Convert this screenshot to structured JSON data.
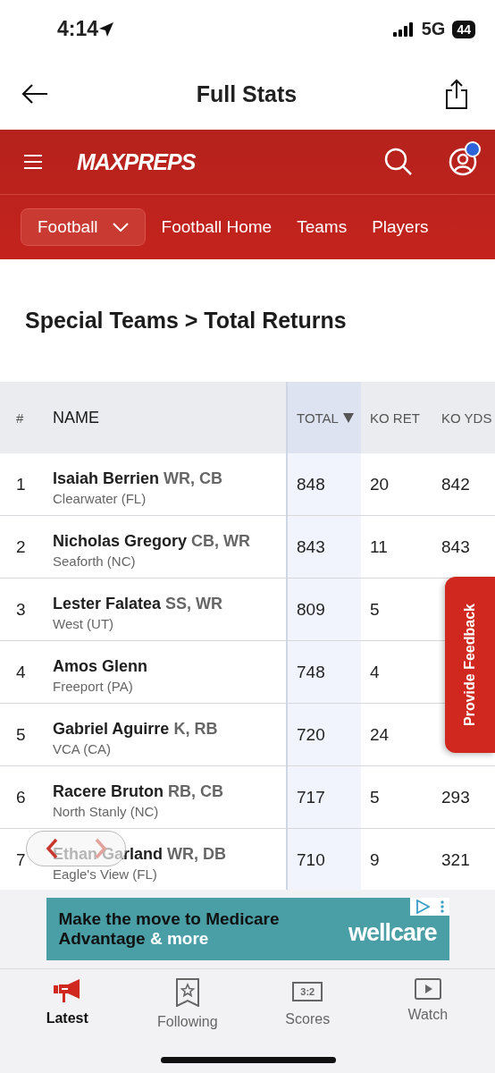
{
  "status_bar": {
    "time": "4:14",
    "network": "5G",
    "battery": "44"
  },
  "header": {
    "title": "Full Stats"
  },
  "brand": {
    "logo": "MAXPREPS",
    "notification": true
  },
  "sport_nav": [
    {
      "kind": "dropdown",
      "label": "Football"
    },
    {
      "kind": "link",
      "label": "Football Home"
    },
    {
      "kind": "link",
      "label": "Teams"
    },
    {
      "kind": "link",
      "label": "Players"
    }
  ],
  "section_title": "Special Teams > Total Returns",
  "table": {
    "columns": [
      {
        "label": "#",
        "sorted": false
      },
      {
        "label": "NAME",
        "sorted": false
      },
      {
        "label": "TOTAL",
        "sorted": true
      },
      {
        "label": "KO RET",
        "sorted": false
      },
      {
        "label": "KO YDS",
        "sorted": false
      }
    ],
    "rows": [
      {
        "rank": "1",
        "name": "Isaiah Berrien",
        "positions": "WR, CB",
        "school": "Clearwater (FL)",
        "total": "848",
        "ko_ret": "20",
        "ko_yds": "842"
      },
      {
        "rank": "2",
        "name": "Nicholas Gregory",
        "positions": "CB, WR",
        "school": "Seaforth (NC)",
        "total": "843",
        "ko_ret": "11",
        "ko_yds": "843"
      },
      {
        "rank": "3",
        "name": "Lester Falatea",
        "positions": "SS, WR",
        "school": "West (UT)",
        "total": "809",
        "ko_ret": "5"
      },
      {
        "rank": "4",
        "name": "Amos Glenn",
        "school": "Freeport (PA)",
        "total": "748",
        "ko_ret": "4"
      },
      {
        "rank": "5",
        "name": "Gabriel Aguirre",
        "positions": "K, RB",
        "school": "VCA (CA)",
        "total": "720",
        "ko_ret": "24"
      },
      {
        "rank": "6",
        "name": "Racere Bruton",
        "positions": "RB, CB",
        "school": "North Stanly (NC)",
        "total": "717",
        "ko_ret": "5",
        "ko_yds": "293"
      },
      {
        "rank": "7",
        "name": "Ethan Garland",
        "positions": "WR, DB",
        "school": "Eagle's View (FL)",
        "total": "710",
        "ko_ret": "9",
        "ko_yds": "321"
      }
    ]
  },
  "feedback_tab": {
    "label": "Provide Feedback"
  },
  "ad": {
    "headline": "Make the move to Medicare Advantage",
    "headline_tail": "& more",
    "brand": "wellcare"
  },
  "bottom_nav": [
    {
      "kind": "latest",
      "label": "Latest",
      "selected": true
    },
    {
      "kind": "following",
      "label": "Following",
      "selected": false
    },
    {
      "kind": "scores",
      "label": "Scores",
      "icon_text": "3:2",
      "selected": false
    },
    {
      "kind": "watch",
      "label": "Watch",
      "selected": false
    }
  ]
}
